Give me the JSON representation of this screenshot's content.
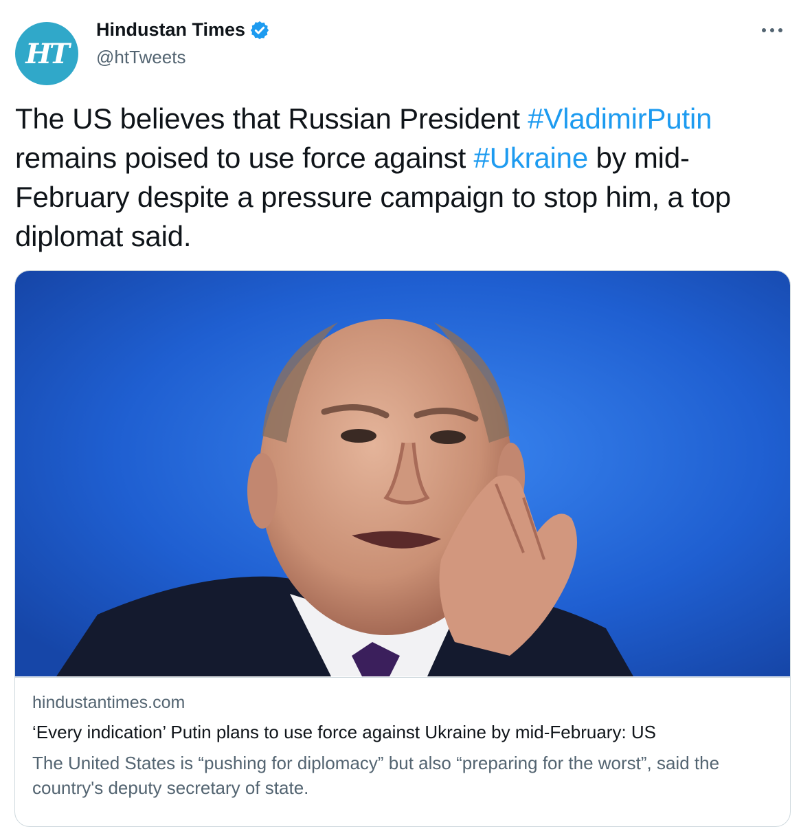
{
  "author": {
    "display_name": "Hindustan Times",
    "handle": "@htTweets",
    "avatar_text": "HT",
    "verified": true,
    "avatar_color": "#30a8c9"
  },
  "tweet": {
    "text_part1": "The US believes that Russian President ",
    "hashtag1": "#VladimirPutin",
    "text_part2": " remains poised to use force against ",
    "hashtag2": "#Ukraine",
    "text_part3": " by mid-February despite a pressure campaign to stop him, a top diplomat said."
  },
  "card": {
    "domain": "hindustantimes.com",
    "title": "‘Every indication’ Putin plans to use force against Ukraine by mid-February: US",
    "description": "The United States is “pushing for diplomacy” but also “preparing for the worst”, said the country's deputy secretary of state."
  },
  "icons": {
    "verified": "verified-badge-icon",
    "more": "more-options-icon"
  },
  "colors": {
    "hashtag": "#1d9bf0",
    "secondary_text": "#536471",
    "image_background": "#1f5fd1"
  }
}
